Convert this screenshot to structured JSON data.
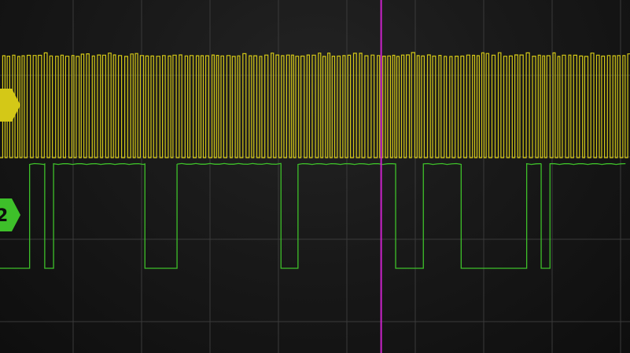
{
  "display": {
    "background": "#161616",
    "grid_color": "#3a3a3a",
    "grid_divisions_horizontal": 9,
    "grid_divisions_vertical": 4
  },
  "channels": [
    {
      "id": "ch1",
      "label": "",
      "color": "#d4c817",
      "marker_icon": "channel-1-marker-icon",
      "signal": "dense-square-wave",
      "gap_positions_fraction": [
        0.19,
        0.386,
        0.584,
        0.785
      ]
    },
    {
      "id": "ch2",
      "label": "2",
      "color": "#3ec02a",
      "marker_icon": "channel-2-marker-icon",
      "signal": "digital-pulse-train",
      "low_intervals_fraction": [
        [
          0.0,
          0.047
        ],
        [
          0.071,
          0.085
        ],
        [
          0.23,
          0.281
        ],
        [
          0.446,
          0.473
        ],
        [
          0.628,
          0.672
        ],
        [
          0.732,
          0.836
        ],
        [
          0.859,
          0.873
        ]
      ]
    }
  ],
  "cursor": {
    "color": "#cc22cc",
    "position_fraction": 0.605
  }
}
